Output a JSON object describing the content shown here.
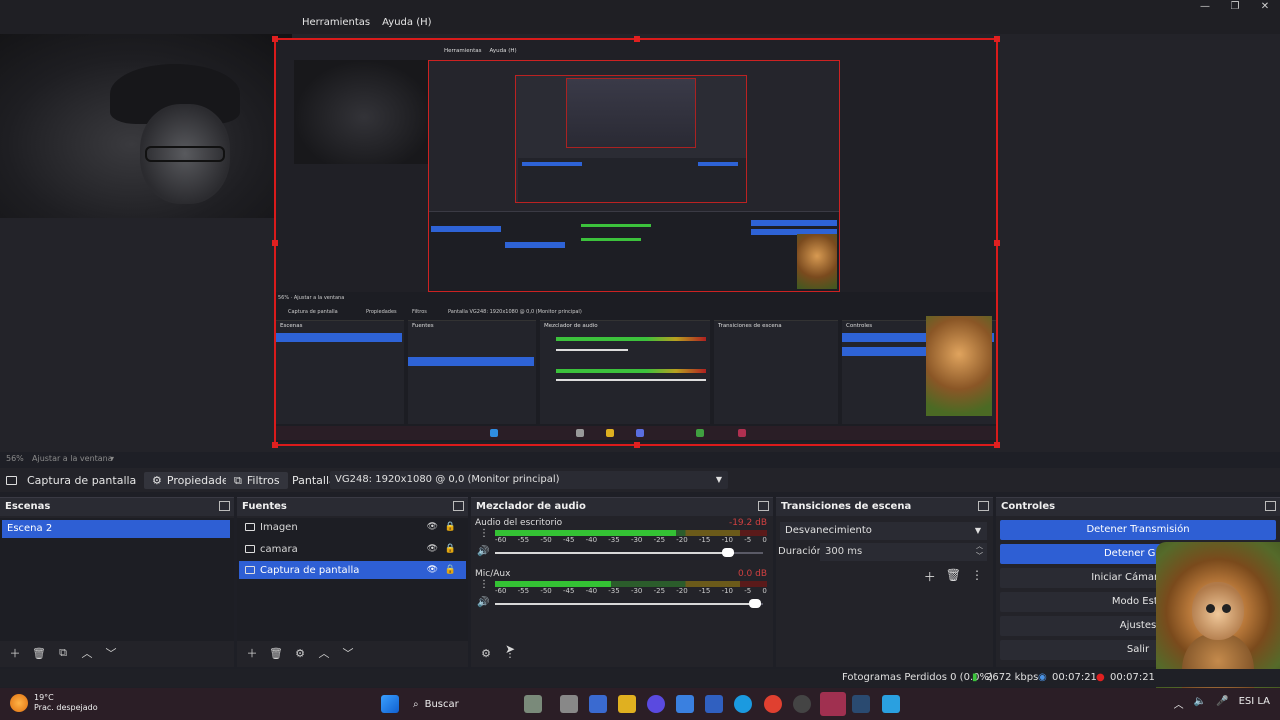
{
  "menu": [
    "Herramientas",
    "Ayuda (H)"
  ],
  "window_controls": [
    "—",
    "❐",
    "✕"
  ],
  "preview": {
    "zoom": "56%",
    "zoom_label": "Ajustar a la ventana",
    "nested_menu": [
      "Herramientas",
      "Ayuda (H)"
    ]
  },
  "toolbar": {
    "source_name": "Captura de pantalla",
    "properties": "Propiedades",
    "filters": "Filtros",
    "display_label": "Pantalla",
    "display_value": "VG248: 1920x1080 @ 0,0 (Monitor principal)"
  },
  "scenes": {
    "title": "Escenas",
    "items": [
      "Escena 2"
    ]
  },
  "sources": {
    "title": "Fuentes",
    "items": [
      {
        "label": "Imagen",
        "icon": "image-icon"
      },
      {
        "label": "camara",
        "icon": "camera-icon"
      },
      {
        "label": "Captura de pantalla",
        "icon": "monitor-icon"
      }
    ]
  },
  "mixer": {
    "title": "Mezclador de audio",
    "ticks": [
      "-60",
      "-55",
      "-50",
      "-45",
      "-40",
      "-35",
      "-30",
      "-25",
      "-20",
      "-15",
      "-10",
      "-5",
      "0"
    ],
    "channels": [
      {
        "name": "Audio del escritorio",
        "db": "-19.2 dB",
        "level": 0.67,
        "volume": 0.9
      },
      {
        "name": "Mic/Aux",
        "db": "0.0 dB",
        "level": 0.43,
        "volume": 1.0
      }
    ]
  },
  "transitions": {
    "title": "Transiciones de escena",
    "selected": "Desvanecimiento",
    "duration_label": "Duración",
    "duration_value": "300 ms"
  },
  "controls": {
    "title": "Controles",
    "buttons": [
      {
        "label": "Detener Transmisión",
        "active": true
      },
      {
        "label": "Detener Grab",
        "active": true
      },
      {
        "label": "Iniciar Cámara Virt",
        "active": false
      },
      {
        "label": "Modo Estu",
        "active": false
      },
      {
        "label": "Ajustes",
        "active": false
      },
      {
        "label": "Salir",
        "active": false
      }
    ]
  },
  "status": {
    "dropped": "Fotogramas Perdidos 0 (0.0%)",
    "kbps": "2672 kbps",
    "stream_time": "00:07:21",
    "rec_time": "00:07:21"
  },
  "taskbar": {
    "temp": "19°C",
    "weather": "Prac. despejado",
    "search": "Buscar",
    "tray_text": "ESI LA"
  },
  "colors": {
    "accent": "#2e5fd4",
    "bounding": "#d91b1b",
    "meter_green": "#34c234"
  }
}
